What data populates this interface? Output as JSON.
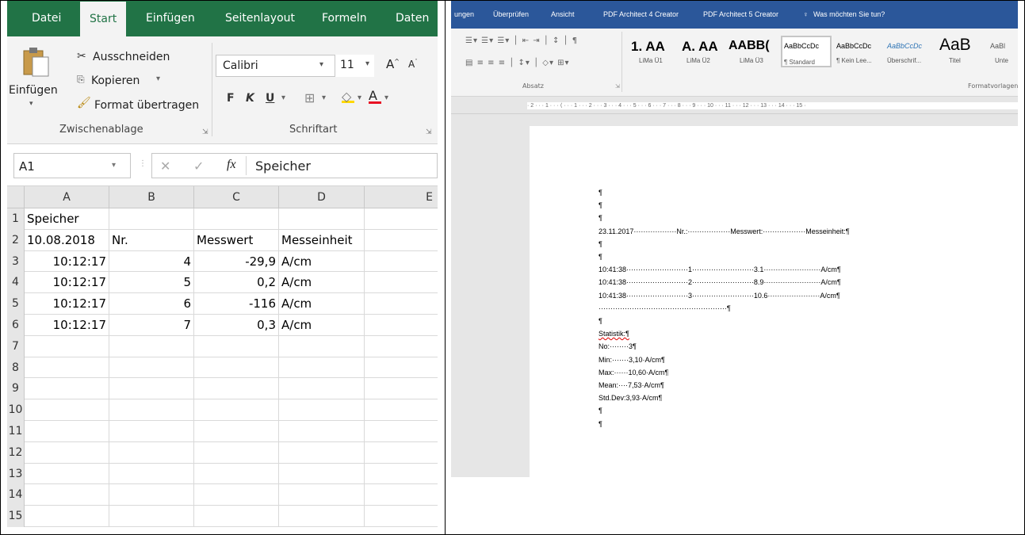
{
  "excel": {
    "tabs": [
      "Datei",
      "Start",
      "Einfügen",
      "Seitenlayout",
      "Formeln",
      "Daten"
    ],
    "clipboard": {
      "paste": "Einfügen",
      "cut": "Ausschneiden",
      "copy": "Kopieren",
      "format_painter": "Format übertragen",
      "group_label": "Zwischenablage"
    },
    "font": {
      "name": "Calibri",
      "size": "11",
      "bold": "F",
      "italic": "K",
      "underline": "U",
      "group_label": "Schriftart"
    },
    "formula_bar": {
      "name_box": "A1",
      "fx": "fx",
      "content": "Speicher"
    },
    "columns": [
      "A",
      "B",
      "C",
      "D",
      "E"
    ],
    "rows": [
      {
        "num": "1",
        "cells": [
          "Speicher",
          "",
          "",
          ""
        ]
      },
      {
        "num": "2",
        "cells": [
          "10.08.2018",
          "Nr.",
          "Messwert",
          "Messeinheit"
        ]
      },
      {
        "num": "3",
        "cells": [
          "10:12:17",
          "4",
          "-29,9",
          "A/cm"
        ]
      },
      {
        "num": "4",
        "cells": [
          "10:12:17",
          "5",
          "0,2",
          "A/cm"
        ]
      },
      {
        "num": "5",
        "cells": [
          "10:12:17",
          "6",
          "-116",
          "A/cm"
        ]
      },
      {
        "num": "6",
        "cells": [
          "10:12:17",
          "7",
          "0,3",
          "A/cm"
        ]
      },
      {
        "num": "7",
        "cells": [
          "",
          "",
          "",
          ""
        ]
      },
      {
        "num": "8",
        "cells": [
          "",
          "",
          "",
          ""
        ]
      },
      {
        "num": "9",
        "cells": [
          "",
          "",
          "",
          ""
        ]
      },
      {
        "num": "10",
        "cells": [
          "",
          "",
          "",
          ""
        ]
      },
      {
        "num": "11",
        "cells": [
          "",
          "",
          "",
          ""
        ]
      },
      {
        "num": "12",
        "cells": [
          "",
          "",
          "",
          ""
        ]
      },
      {
        "num": "13",
        "cells": [
          "",
          "",
          "",
          ""
        ]
      },
      {
        "num": "14",
        "cells": [
          "",
          "",
          "",
          ""
        ]
      },
      {
        "num": "15",
        "cells": [
          "",
          "",
          "",
          ""
        ]
      }
    ]
  },
  "word": {
    "tabs": [
      "ungen",
      "Überprüfen",
      "Ansicht",
      "PDF Architect 4 Creator",
      "PDF Architect 5 Creator",
      "Was möchten Sie tun?"
    ],
    "group_labels": {
      "paragraph": "Absatz",
      "styles": "Formatvorlagen"
    },
    "styles": [
      {
        "preview": "1. AA",
        "name": "LiMa Ü1"
      },
      {
        "preview": "A. AA",
        "name": "LiMa Ü2"
      },
      {
        "preview": "AABB(",
        "name": "LiMa Ü3"
      },
      {
        "preview": "AaBbCcDc",
        "name": "¶ Standard"
      },
      {
        "preview": "AaBbCcDc",
        "name": "¶ Kein Lee..."
      },
      {
        "preview": "AaBbCcDc",
        "name": "Überschrif..."
      },
      {
        "preview": "AaB",
        "name": "Titel"
      },
      {
        "preview": "AaBl",
        "name": "Unte"
      }
    ],
    "ruler": "· 2 · · · 1 · · · ⟨ · · · 1 · · · 2 · · · 3 · · · 4 · · · 5 · · · 6 · · · 7 · · · 8 · · · 9 · · · 10 · · · 11 · · · 12 · · · 13 · · · 14 · · · 15 ·",
    "doc_lines": [
      "¶",
      "¶",
      "¶",
      "23.11.2017··················Nr.:··················Messwert:··················Messeinheit:¶",
      "¶",
      "¶",
      "10:41:38··························1··························3.1························A/cm¶",
      "10:41:38··························2··························8.9························A/cm¶",
      "10:41:38··························3··························10.6······················A/cm¶",
      "······················································¶",
      "¶",
      "Statistik:¶",
      "No:········3¶",
      "Min:·······3,10·A/cm¶",
      "Max:······10,60·A/cm¶",
      "Mean:····7,53·A/cm¶",
      "Std.Dev:3,93·A/cm¶",
      "¶",
      "¶"
    ]
  },
  "colors": {
    "excel_green": "#217346",
    "word_blue": "#2b579a",
    "font_color_red": "#e81123"
  }
}
